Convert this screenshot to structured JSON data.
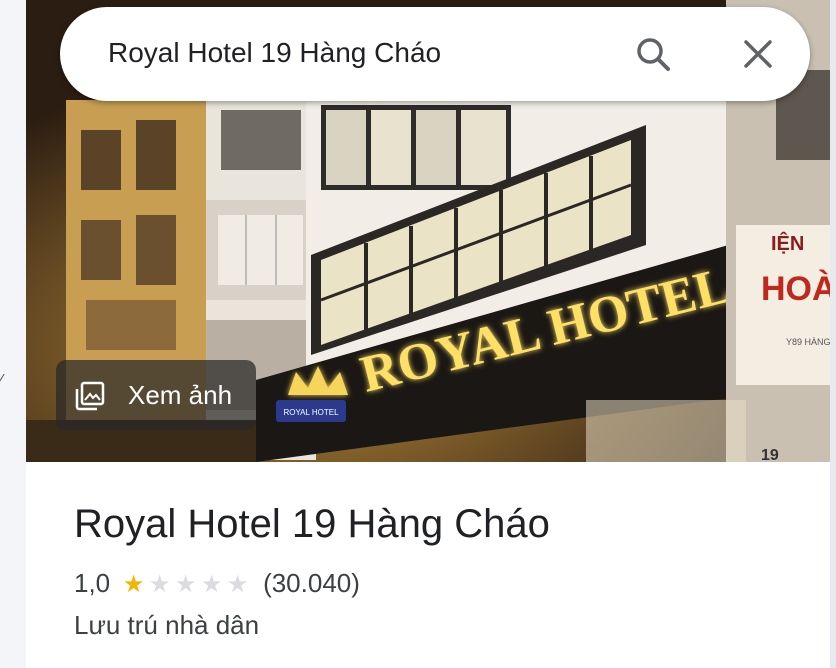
{
  "search": {
    "query": "Royal Hotel 19 Hàng Cháo",
    "search_icon": "search-icon",
    "close_icon": "close-icon"
  },
  "photo": {
    "view_photos_label": "Xem ảnh",
    "photos_icon": "photo-library-icon",
    "sign_text": "ROYAL HOTEL",
    "side_sign_text": "HOÀ",
    "side_sign_top": "IỆN",
    "side_sign_small": "Y89 HÀNG",
    "logo_text": "ROYAL HOTEL",
    "address_number": "19"
  },
  "place": {
    "title": "Royal Hotel 19 Hàng Cháo",
    "rating_value": "1,0",
    "rating_stars": 1,
    "rating_max": 5,
    "review_count": "(30.040)",
    "category": "Lưu trú nhà dân"
  },
  "colors": {
    "star_filled": "#f4b400",
    "star_empty": "#dadce0",
    "sign_glow": "#ffe066"
  }
}
